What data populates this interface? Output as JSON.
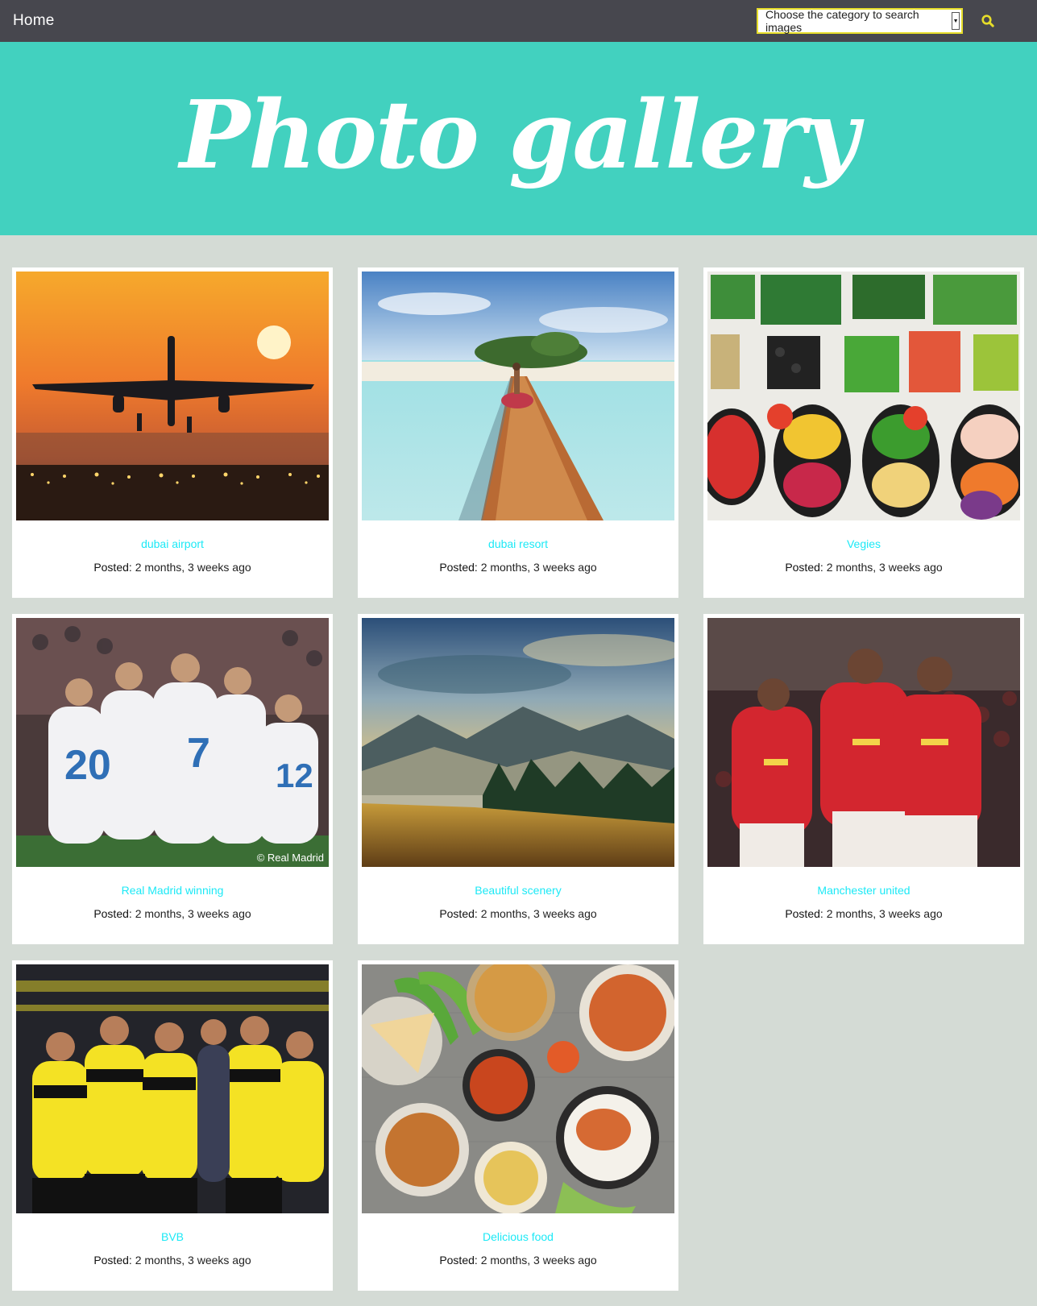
{
  "nav": {
    "home_label": "Home",
    "category_placeholder": "Choose the category to search images",
    "search_icon": "search-icon",
    "accent": "#e6dd2a"
  },
  "hero": {
    "title": "Photo gallery",
    "background": "#42d1bf"
  },
  "gallery": {
    "posted_label": "Posted:",
    "title_color": "#1ce9f6",
    "items": [
      {
        "title": "dubai airport",
        "posted": "2 months, 3 weeks ago",
        "image": "airplane-sunset-photo"
      },
      {
        "title": "dubai resort",
        "posted": "2 months, 3 weeks ago",
        "image": "island-boardwalk-photo"
      },
      {
        "title": "Vegies",
        "posted": "2 months, 3 weeks ago",
        "image": "vegetable-platter-photo"
      },
      {
        "title": "Real Madrid winning",
        "posted": "2 months, 3 weeks ago",
        "image": "real-madrid-team-photo",
        "watermark": "© Real Madrid"
      },
      {
        "title": "Beautiful scenery",
        "posted": "2 months, 3 weeks ago",
        "image": "mountain-landscape-photo"
      },
      {
        "title": "Manchester united",
        "posted": "2 months, 3 weeks ago",
        "image": "manchester-united-players-photo"
      },
      {
        "title": "BVB",
        "posted": "2 months, 3 weeks ago",
        "image": "bvb-team-photo"
      },
      {
        "title": "Delicious food",
        "posted": "2 months, 3 weeks ago",
        "image": "food-spread-photo"
      }
    ]
  }
}
